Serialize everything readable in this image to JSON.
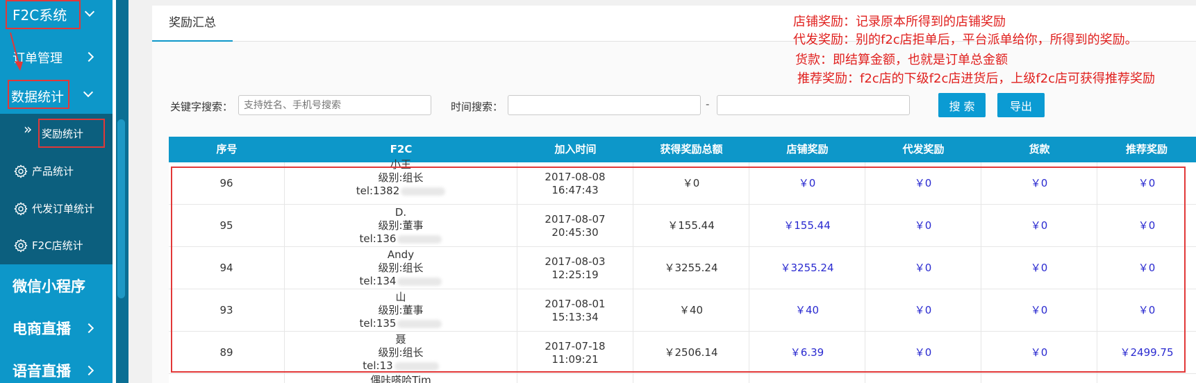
{
  "sidebar": {
    "f2c_system": "F2C系统",
    "order_management": "订单管理",
    "data_statistics": "数据统计",
    "reward_statistics": "奖励统计",
    "product_statistics": "产品统计",
    "dropship_order_statistics": "代发订单统计",
    "f2c_store_statistics": "F2C店统计",
    "wechat_miniprogram": "微信小程序",
    "ecommerce_live": "电商直播",
    "voice_live": "语音直播"
  },
  "tabs": {
    "reward_summary": "奖励汇总"
  },
  "notes": {
    "store_reward": "店铺奖励：记录原本所得到的店铺奖励",
    "dropship_reward": "代发奖励：别的f2c店拒单后，平台派单给你，所得到的奖励。",
    "payment": "货款：即结算金额，也就是订单总金额",
    "referral_reward": "推荐奖励：f2c店的下级f2c店进货后，上级f2c店可获得推荐奖励"
  },
  "search": {
    "keyword_label": "关键字搜索：",
    "keyword_placeholder": "支持姓名、手机号搜索",
    "time_label": "时间搜索：",
    "separator": "-",
    "search_button": "搜 索",
    "export_button": "导出"
  },
  "table": {
    "headers": [
      "序号",
      "F2C",
      "加入时间",
      "获得奖励总额",
      "店铺奖励",
      "代发奖励",
      "货款",
      "推荐奖励"
    ],
    "rows": [
      {
        "id": "96",
        "name": "小王",
        "level": "级别:组长",
        "tel": "tel:1382",
        "join_date": "2017-08-08",
        "join_time": "16:47:43",
        "total": "￥0",
        "store": "￥0",
        "dropship": "￥0",
        "payment": "￥0",
        "referral": "￥0"
      },
      {
        "id": "95",
        "name": "D.",
        "level": "级别:董事",
        "tel": "tel:136",
        "join_date": "2017-08-07",
        "join_time": "20:45:30",
        "total": "￥155.44",
        "store": "￥155.44",
        "dropship": "￥0",
        "payment": "￥0",
        "referral": "￥0"
      },
      {
        "id": "94",
        "name": "Andy",
        "level": "级别:组长",
        "tel": "tel:134",
        "join_date": "2017-08-03",
        "join_time": "12:25:19",
        "total": "￥3255.24",
        "store": "￥3255.24",
        "dropship": "￥0",
        "payment": "￥0",
        "referral": "￥0"
      },
      {
        "id": "93",
        "name": "山",
        "level": "级别:董事",
        "tel": "tel:135",
        "join_date": "2017-08-01",
        "join_time": "15:13:34",
        "total": "￥40",
        "store": "￥40",
        "dropship": "￥0",
        "payment": "￥0",
        "referral": "￥0"
      },
      {
        "id": "89",
        "name": "聂",
        "level": "级别:组长",
        "tel": "tel:13",
        "join_date": "2017-07-18",
        "join_time": "11:09:21",
        "total": "￥2506.14",
        "store": "￥6.39",
        "dropship": "￥0",
        "payment": "￥0",
        "referral": "￥2499.75"
      }
    ],
    "partial_row_name": "偶咔嗒哈Tim"
  },
  "colors": {
    "sidebar": "#0d97c9",
    "submenu": "#0c5f7e",
    "accent": "#0b9bd3",
    "annotation": "#e0201e",
    "amount_blue": "#2a2ad0"
  }
}
